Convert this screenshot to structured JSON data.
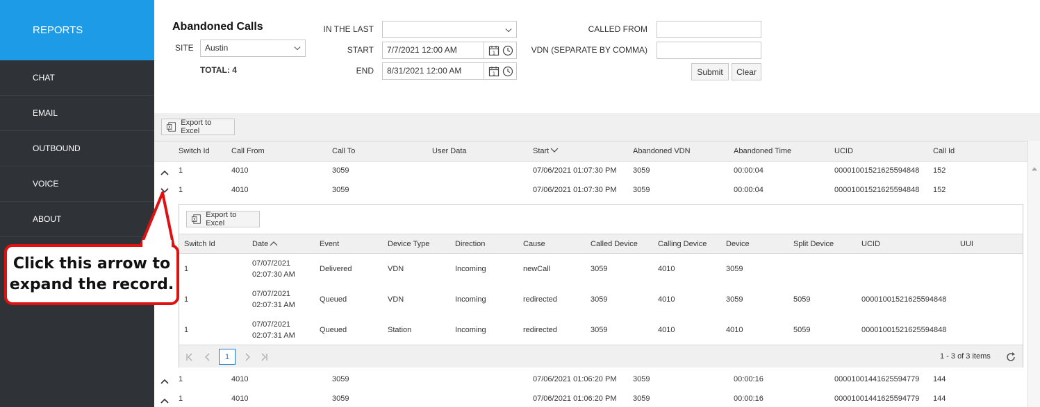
{
  "sidebar": {
    "brand": "REPORTS",
    "items": [
      "CHAT",
      "EMAIL",
      "OUTBOUND",
      "VOICE",
      "ABOUT"
    ]
  },
  "filters": {
    "title": "Abandoned Calls",
    "site_label": "SITE",
    "site_value": "Austin",
    "total": "TOTAL: 4",
    "in_last_label": "IN THE LAST",
    "in_last_value": "",
    "start_label": "START",
    "start_value": "7/7/2021 12:00 AM",
    "end_label": "END",
    "end_value": "8/31/2021 12:00 AM",
    "called_from_label": "CALLED FROM",
    "called_from_value": "",
    "vdn_label": "VDN (SEPARATE BY COMMA)",
    "vdn_value": "",
    "submit": "Submit",
    "clear": "Clear"
  },
  "grid": {
    "export_label": "Export to Excel",
    "columns": [
      "Switch Id",
      "Call From",
      "Call To",
      "User Data",
      "Start",
      "Abandoned VDN",
      "Abandoned Time",
      "UCID",
      "Call Id"
    ],
    "rows": [
      [
        "1",
        "4010",
        "3059",
        "",
        "07/06/2021 01:07:30 PM",
        "3059",
        "00:00:04",
        "00001001521625594848",
        "152"
      ],
      [
        "1",
        "4010",
        "3059",
        "",
        "07/06/2021 01:07:30 PM",
        "3059",
        "00:00:04",
        "00001001521625594848",
        "152"
      ],
      [
        "1",
        "4010",
        "3059",
        "",
        "07/06/2021 01:06:20 PM",
        "3059",
        "00:00:16",
        "00001001441625594779",
        "144"
      ],
      [
        "1",
        "4010",
        "3059",
        "",
        "07/06/2021 01:06:20 PM",
        "3059",
        "00:00:16",
        "00001001441625594779",
        "144"
      ]
    ]
  },
  "detail": {
    "export_label": "Export to Excel",
    "columns": [
      "Switch Id",
      "Date",
      "Event",
      "Device Type",
      "Direction",
      "Cause",
      "Called Device",
      "Calling Device",
      "Device",
      "Split Device",
      "UCID",
      "UUI"
    ],
    "rows": [
      {
        "switch": "1",
        "date1": "07/07/2021",
        "date2": "02:07:30 AM",
        "event": "Delivered",
        "device_type": "VDN",
        "direction": "Incoming",
        "cause": "newCall",
        "called": "3059",
        "calling": "4010",
        "device": "3059",
        "split": "",
        "ucid": "",
        "uui": ""
      },
      {
        "switch": "1",
        "date1": "07/07/2021",
        "date2": "02:07:31 AM",
        "event": "Queued",
        "device_type": "VDN",
        "direction": "Incoming",
        "cause": "redirected",
        "called": "3059",
        "calling": "4010",
        "device": "3059",
        "split": "5059",
        "ucid": "00001001521625594848",
        "uui": ""
      },
      {
        "switch": "1",
        "date1": "07/07/2021",
        "date2": "02:07:31 AM",
        "event": "Queued",
        "device_type": "Station",
        "direction": "Incoming",
        "cause": "redirected",
        "called": "3059",
        "calling": "4010",
        "device": "4010",
        "split": "5059",
        "ucid": "00001001521625594848",
        "uui": ""
      }
    ],
    "page": "1",
    "items_info": "1 - 3 of 3 items"
  },
  "callout": {
    "line1": "Click this arrow to",
    "line2": "expand the record."
  },
  "colors": {
    "brand": "#1e9be6",
    "sidebar": "#2f3338",
    "callout_border": "#e01010"
  }
}
